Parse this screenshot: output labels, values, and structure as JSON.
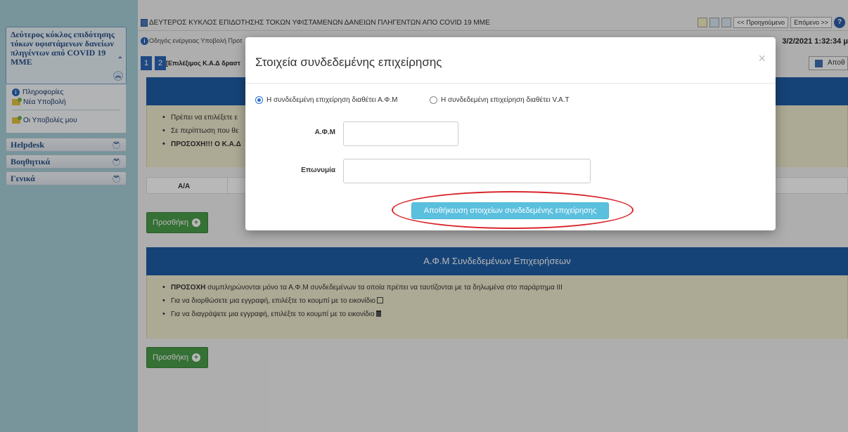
{
  "sidebar": {
    "header_title": "Δεύτερος κύκλος επιδότησης τόκων υφιστάμενων δανείων πληγέντων από COVID 19 ΜΜΕ",
    "menu": [
      {
        "label": "Πληροφορίες",
        "icon": "info-icon"
      },
      {
        "label": "Νέα Υποβολή",
        "icon": "folder-add-icon"
      },
      {
        "label": "Οι Υποβολές μου",
        "icon": "folder-icon"
      }
    ],
    "sections": [
      {
        "label": "Helpdesk"
      },
      {
        "label": "Βοηθητικά"
      },
      {
        "label": "Γενικά"
      }
    ]
  },
  "topbar": {
    "title": "ΔΕΥΤΕΡΟΣ ΚΥΚΛΟΣ ΕΠΙΔΟΤΗΣΗΣ ΤΟΚΩΝ ΥΦΙΣΤΑΜΕΝΩΝ ΔΑΝΕΙΩΝ ΠΛΗΓΕΝΤΩΝ ΑΠΟ COVID 19 ΜΜΕ",
    "prev_label": "<< Προηγούμενο",
    "next_label": "Επόμενο >>"
  },
  "guide": {
    "text": "Οδηγός ενέργειας Υποβολή Προτ",
    "datetime": "3/2/2021 1:32:34 μ"
  },
  "steps": {
    "step1": "1",
    "step2": "2",
    "label": "[Επιλέξιμος Κ.Α.Δ δραστ",
    "save_label": "Αποθ"
  },
  "section1": {
    "bullets": [
      "Πρέπει να επιλέξετε ε",
      "Σε περίπτωση που θε",
      "ΠΡΟΣΟΧΗ!!! Ο Κ.Α.Δ"
    ],
    "table_col": "Α/Α",
    "add_label": "Προσθήκη"
  },
  "section2": {
    "title": "Α.Φ.Μ Συνδεδεμένων Επιχειρήσεων",
    "bullet1_bold": "ΠΡΟΣΟΧΗ",
    "bullet1_rest": " συμπληρώνονται μόνο τα Α.Φ.Μ συνδεδεμένων τα οποία πρέπει να ταυτίζονται με τα δηλωμένα στο παράρτημα ΙΙΙ",
    "bullet2": "Για να διορθώσετε μια εγγραφή, επιλέξτε το κουμπί με το εικονίδιο",
    "bullet3": "Για να διαγράψετε μια εγγραφή, επιλέξτε το κουμπί με το εικονίδιο",
    "add_label": "Προσθήκη"
  },
  "modal": {
    "title": "Στοιχεία συνδεδεμένης επιχείρησης",
    "close": "×",
    "radio_afm": "Η συνδεδεμένη επιχείρηση διαθέτει Α.Φ.Μ",
    "radio_vat": "Η συνδεδεμένη επιχείρηση διαθέτει V.A.T",
    "afm_label": "Α.Φ.Μ",
    "afm_value": "",
    "name_label": "Επωνυμία",
    "name_value": "",
    "save_label": "Αποθήκευση στοιχείων συνδεδεμένης επιχείρησης"
  },
  "colors": {
    "sidebar_bg": "#a6cfd7",
    "panel_header": "#1f5ea6",
    "notice_bg": "#efeacd",
    "add_button": "#4a9b4a",
    "save_button": "#5bc0de",
    "highlight": "#d9252b"
  }
}
